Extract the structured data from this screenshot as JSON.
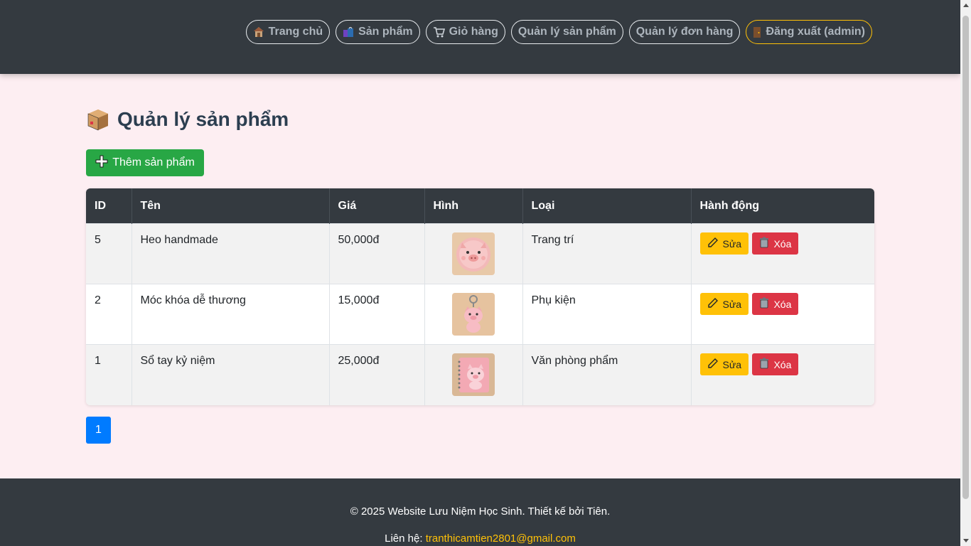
{
  "nav": [
    {
      "label": "Trang chủ",
      "icon": "house-icon"
    },
    {
      "label": "Sản phẩm",
      "icon": "shopping-bags-icon"
    },
    {
      "label": "Giỏ hàng",
      "icon": "cart-icon"
    },
    {
      "label": "Quản lý sản phẩm",
      "icon": ""
    },
    {
      "label": "Quản lý đơn hàng",
      "icon": ""
    },
    {
      "label": "Đăng xuất (admin)",
      "icon": "door-icon"
    }
  ],
  "page": {
    "title": "Quản lý sản phẩm",
    "title_icon": "package-icon",
    "add_button": "Thêm sản phẩm",
    "add_icon": "plus-icon"
  },
  "table": {
    "columns": [
      "ID",
      "Tên",
      "Giá",
      "Hình",
      "Loại",
      "Hành động"
    ],
    "rows": [
      {
        "id": "5",
        "name": "Heo handmade",
        "price": "50,000đ",
        "image": "pig-coaster-image",
        "category": "Trang trí"
      },
      {
        "id": "2",
        "name": "Móc khóa dễ thương",
        "price": "15,000đ",
        "image": "pig-keychain-image",
        "category": "Phụ kiện"
      },
      {
        "id": "1",
        "name": "Sổ tay kỷ niệm",
        "price": "25,000đ",
        "image": "pig-notebook-image",
        "category": "Văn phòng phẩm"
      }
    ],
    "edit_label": "Sửa",
    "delete_label": "Xóa"
  },
  "pagination": {
    "current": "1"
  },
  "footer": {
    "copyright": "© 2025 Website Lưu Niệm Học Sinh. Thiết kế bởi Tiên.",
    "contact_label": "Liên hệ:",
    "email": "tranthicamtien2801@gmail.com"
  },
  "colors": {
    "header_bg": "#343a40",
    "page_bg": "#fdeef2",
    "add_green": "#28a745",
    "edit_yellow": "#ffc107",
    "delete_red": "#dc3545",
    "page_blue": "#007bff"
  }
}
